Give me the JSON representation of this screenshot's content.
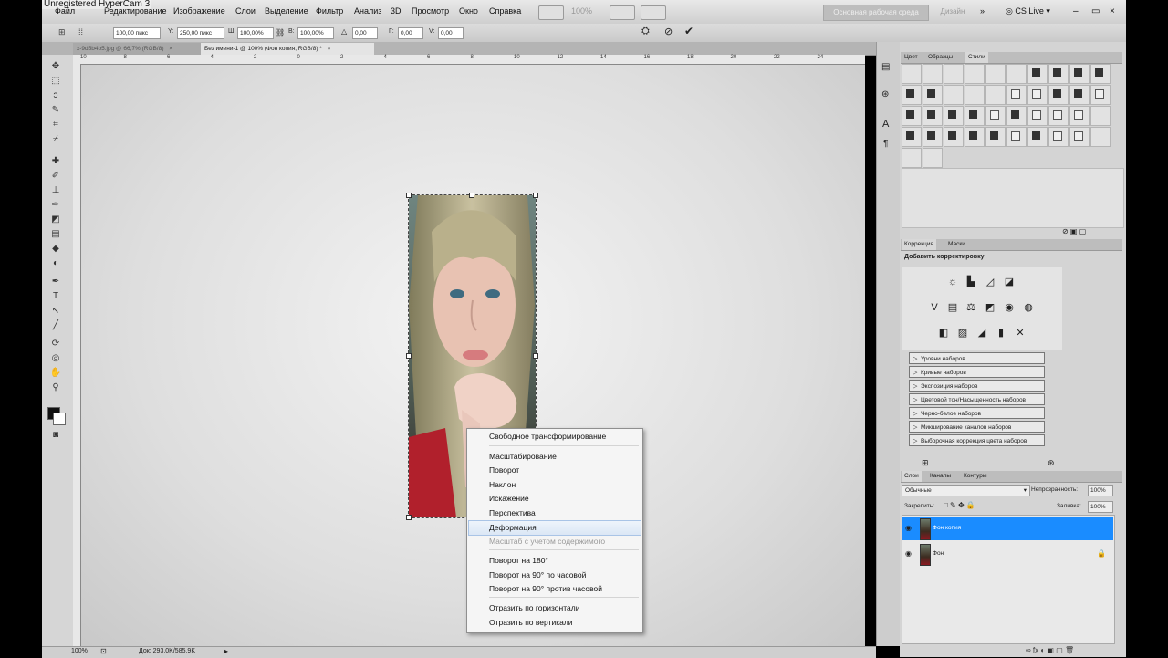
{
  "watermark": "Unregistered HyperCam 3",
  "menu": {
    "items": [
      "Файл",
      "Редактирование",
      "Изображение",
      "Слои",
      "Выделение",
      "Фильтр",
      "Анализ",
      "3D",
      "Просмотр",
      "Окно",
      "Справка"
    ],
    "zoom": "100%",
    "workspace_label": "Основная рабочая среда",
    "design_label": "Дизайн",
    "more": "»",
    "cs_live": "CS Live",
    "min": "–",
    "restore": "▭",
    "close": "×"
  },
  "options": {
    "x_value": "100,00 пикс",
    "y_label": "Y:",
    "y_value": "250,00 пикс",
    "w_label": "Ш:",
    "w_value": "100,00%",
    "h_label": "В:",
    "h_value": "100,00%",
    "angle_value": "0,00",
    "hskew_label": "Г:",
    "hskew_value": "0,00",
    "vskew_label": "V:",
    "vskew_value": "0,00"
  },
  "tabs": [
    {
      "label": "x-9d5b4b5.jpg @ 66,7% (RGB/8)",
      "close": "×"
    },
    {
      "label": "Без имени-1 @ 100% (Фон копия, RGB/8) *",
      "close": "×"
    }
  ],
  "ruler": [
    "10",
    "8",
    "6",
    "4",
    "2",
    "0",
    "2",
    "4",
    "6",
    "8",
    "10",
    "12",
    "14",
    "16",
    "18",
    "20",
    "22",
    "24"
  ],
  "context_menu": {
    "items": [
      {
        "label": "Свободное трансформирование",
        "state": "normal"
      },
      {
        "label": "Масштабирование",
        "state": "normal"
      },
      {
        "label": "Поворот",
        "state": "normal"
      },
      {
        "label": "Наклон",
        "state": "normal"
      },
      {
        "label": "Искажение",
        "state": "normal"
      },
      {
        "label": "Перспектива",
        "state": "normal"
      },
      {
        "label": "Деформация",
        "state": "hover"
      },
      {
        "label": "Масштаб с учетом содержимого",
        "state": "disabled"
      },
      {
        "label": "Поворот на 180°",
        "state": "normal"
      },
      {
        "label": "Поворот на 90° по часовой",
        "state": "normal"
      },
      {
        "label": "Поворот на 90° против часовой",
        "state": "normal"
      },
      {
        "label": "Отразить по горизонтали",
        "state": "normal"
      },
      {
        "label": "Отразить по вертикали",
        "state": "normal"
      }
    ]
  },
  "status": {
    "zoom": "100%",
    "doc": "Док: 293,0K/585,9K"
  },
  "styles_panel": {
    "tabs": [
      "Цвет",
      "Образцы",
      "Стили"
    ]
  },
  "correction_panel": {
    "tabs": [
      "Коррекция",
      "Маски"
    ],
    "title": "Добавить корректировку",
    "presets": [
      "Уровни наборов",
      "Кривые наборов",
      "Экспозиция наборов",
      "Цветовой тон/Насыщенность наборов",
      "Черно-белое наборов",
      "Микширование каналов наборов",
      "Выборочная коррекция цвета наборов"
    ]
  },
  "layers_panel": {
    "tabs": [
      "Слои",
      "Каналы",
      "Контуры"
    ],
    "blend_mode": "Обычные",
    "opacity_label": "Непрозрачность:",
    "opacity_value": "100%",
    "lock_label": "Закрепить:",
    "fill_label": "Заливка:",
    "fill_value": "100%",
    "layers": [
      {
        "name": "Фон копия",
        "selected": true
      },
      {
        "name": "Фон",
        "selected": false
      }
    ]
  },
  "colors": {
    "selection": "#1a8cff",
    "menu_hover": "#dbe7f5"
  }
}
